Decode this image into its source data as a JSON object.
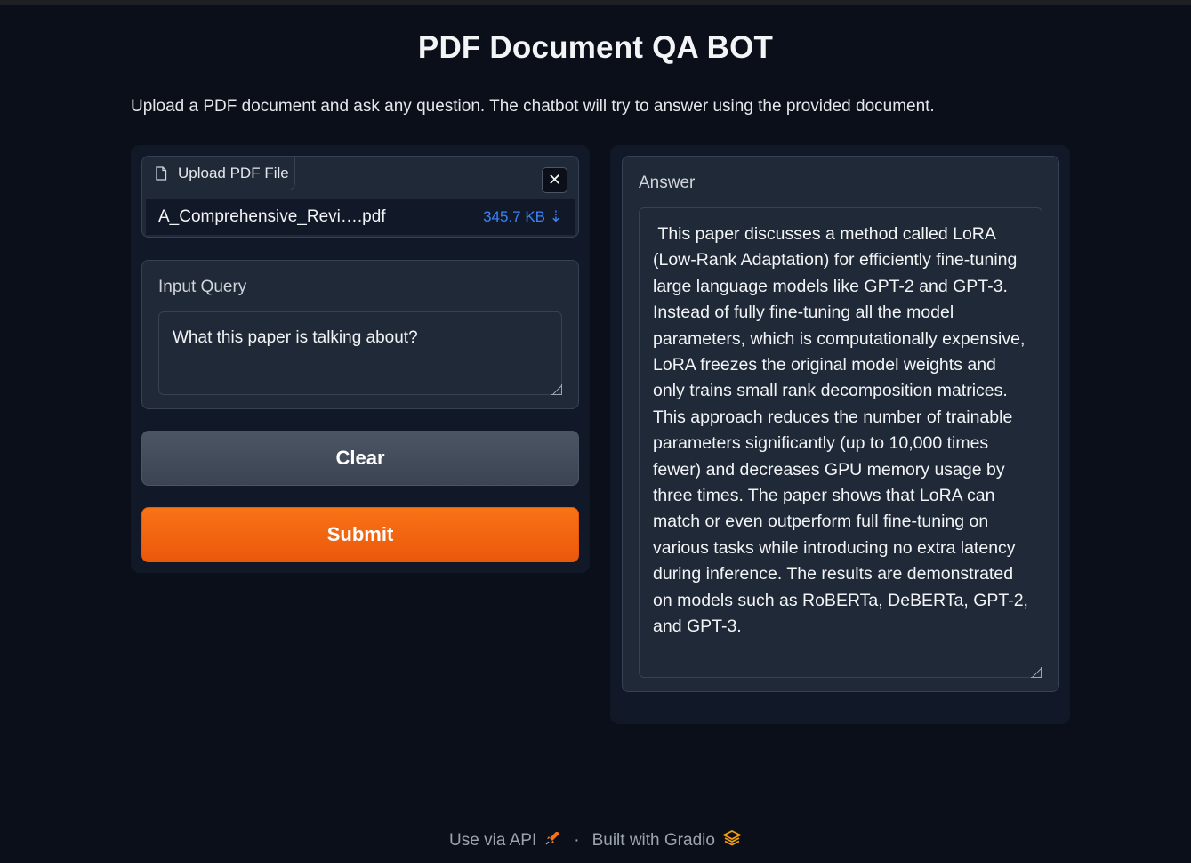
{
  "header": {
    "title": "PDF Document QA BOT",
    "description": "Upload a PDF document and ask any question. The chatbot will try to answer using the provided document."
  },
  "upload": {
    "label": "Upload PDF File",
    "file_name": "A_Comprehensive_Revi….pdf",
    "file_size": "345.7 KB ⇣",
    "close_glyph": "✕"
  },
  "query": {
    "label": "Input Query",
    "value": "What this paper is talking about?"
  },
  "buttons": {
    "clear": "Clear",
    "submit": "Submit"
  },
  "answer": {
    "label": "Answer",
    "value": " This paper discusses a method called LoRA (Low-Rank Adaptation) for efficiently fine-tuning large language models like GPT-2 and GPT-3. Instead of fully fine-tuning all the model parameters, which is computationally expensive, LoRA freezes the original model weights and only trains small rank decomposition matrices. This approach reduces the number of trainable parameters significantly (up to 10,000 times fewer) and decreases GPU memory usage by three times. The paper shows that LoRA can match or even outperform full fine-tuning on various tasks while introducing no extra latency during inference. The results are demonstrated on models such as RoBERTa, DeBERTa, GPT-2, and GPT-3."
  },
  "footer": {
    "api_link": "Use via API",
    "separator": "·",
    "built_with": "Built with Gradio"
  },
  "colors": {
    "accent": "#f97316",
    "background": "#0b0f19",
    "panel": "#111827",
    "file_size": "#3b82f6"
  },
  "icons": [
    "file-icon",
    "close-icon",
    "rocket-icon",
    "gradio-logo-icon",
    "resize-grip-icon"
  ]
}
